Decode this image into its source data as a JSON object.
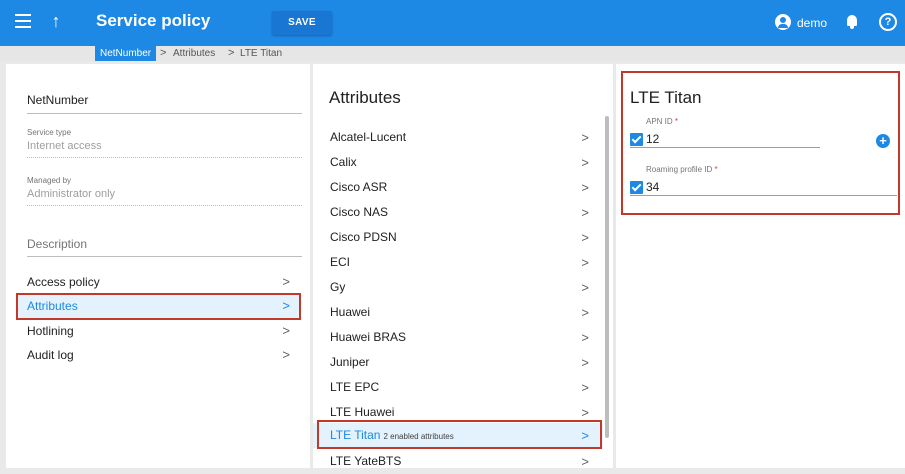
{
  "header": {
    "title": "Service policy",
    "save_label": "SAVE",
    "user_name": "demo",
    "help_glyph": "?",
    "accent_color": "#1e88e5"
  },
  "breadcrumb": {
    "items": [
      "NetNumber",
      "Attributes",
      "LTE Titan"
    ],
    "separator": ">"
  },
  "left_panel": {
    "name": "NetNumber",
    "service_type_label": "Service type",
    "service_type_value": "Internet access",
    "managed_by_label": "Managed by",
    "managed_by_value": "Administrator only",
    "description_placeholder": "Description",
    "nav": [
      {
        "label": "Access policy"
      },
      {
        "label": "Attributes"
      },
      {
        "label": "Hotlining"
      },
      {
        "label": "Audit log"
      }
    ],
    "selected": "Attributes"
  },
  "attributes_panel": {
    "title": "Attributes",
    "items": [
      {
        "label": "Alcatel-Lucent"
      },
      {
        "label": "Calix"
      },
      {
        "label": "Cisco ASR"
      },
      {
        "label": "Cisco NAS"
      },
      {
        "label": "Cisco PDSN"
      },
      {
        "label": "ECI"
      },
      {
        "label": "Gy"
      },
      {
        "label": "Huawei"
      },
      {
        "label": "Huawei BRAS"
      },
      {
        "label": "Juniper"
      },
      {
        "label": "LTE EPC"
      },
      {
        "label": "LTE Huawei"
      },
      {
        "label": "LTE Titan",
        "sub": "2 enabled attributes"
      },
      {
        "label": "LTE YateBTS"
      }
    ],
    "chevron": ">",
    "selected": "LTE Titan"
  },
  "detail_panel": {
    "title": "LTE Titan",
    "fields": [
      {
        "label": "APN ID",
        "required_mark": "*",
        "value": "12",
        "checked": true
      },
      {
        "label": "Roaming profile ID",
        "required_mark": "*",
        "value": "34",
        "checked": true
      }
    ],
    "add_glyph": "+"
  }
}
